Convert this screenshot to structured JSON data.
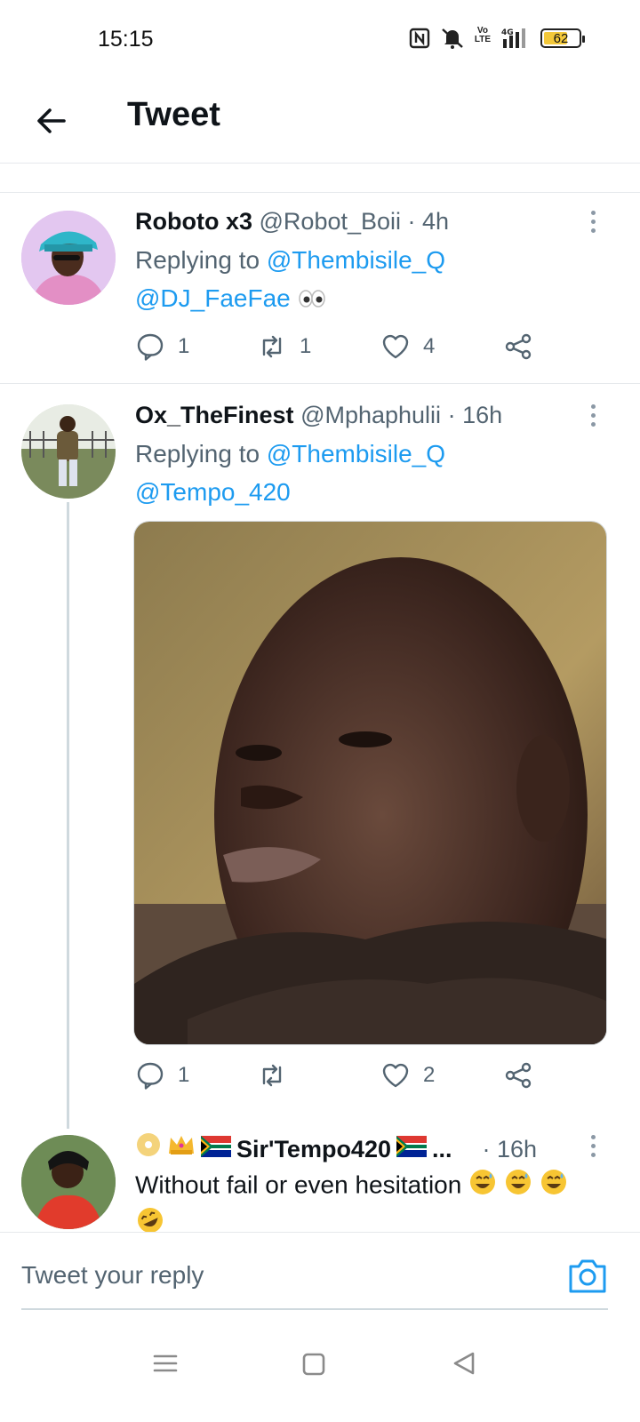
{
  "status_bar": {
    "time": "15:15",
    "battery": "62",
    "network_label": "4G",
    "volte_label": "Vo LTE"
  },
  "header": {
    "title": "Tweet"
  },
  "tweets": [
    {
      "display_name": "Roboto x3",
      "handle": "@Robot_Boii",
      "time": "· 4h",
      "replying_prefix": "Replying to",
      "replying_to": "@Thembisile_Q",
      "text": "@DJ_FaeFae",
      "text_emoji": "eyes",
      "replies": "1",
      "retweets": "1",
      "likes": "4"
    },
    {
      "display_name": "Ox_TheFinest",
      "handle": "@Mphaphulii",
      "time": "· 16h",
      "replying_prefix": "Replying to",
      "replying_to": "@Thembisile_Q",
      "text": "@Tempo_420",
      "replies": "1",
      "retweets": "",
      "likes": "2"
    },
    {
      "display_name": "Sir'Tempo420",
      "name_suffix": "...",
      "time": "· 16h",
      "text": "Without fail or even hesitation",
      "name_emojis": [
        "dvd",
        "crown",
        "south-africa-flag"
      ],
      "text_emojis": [
        "grinning-sweat",
        "grinning-sweat",
        "grinning-sweat",
        "rolling-laughing"
      ]
    }
  ],
  "composer": {
    "placeholder": "Tweet your reply"
  },
  "colors": {
    "link": "#1d9bf0",
    "secondary_text": "#536471",
    "divider": "#e6e9ec"
  }
}
